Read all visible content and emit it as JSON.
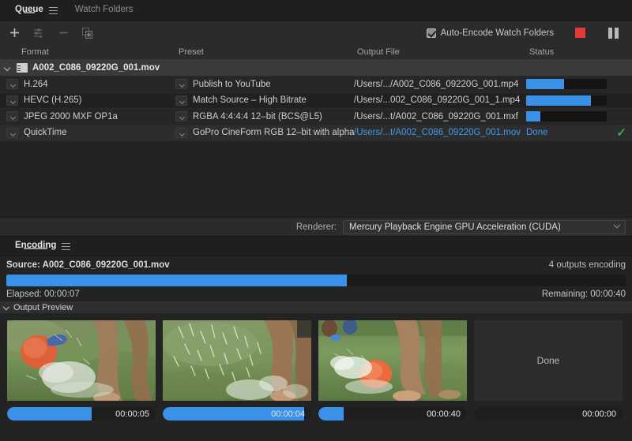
{
  "queue_panel": {
    "tabs": [
      {
        "label": "Queue",
        "active": true,
        "has_menu": true
      },
      {
        "label": "Watch Folders",
        "active": false,
        "has_menu": false
      }
    ],
    "toolbar": {
      "add_icon": "plus-icon",
      "preset_icon": "add-preset-icon",
      "remove_icon": "minus-icon",
      "duplicate_icon": "duplicate-icon",
      "auto_encode_label": "Auto-Encode Watch Folders",
      "auto_encode_checked": true,
      "stop_icon": "stop-button",
      "pause_icon": "pause-button"
    },
    "columns": [
      "Format",
      "Preset",
      "Output File",
      "Status"
    ],
    "group": {
      "name": "A002_C086_09220G_001.mov",
      "expanded": true,
      "icon": "source-clip-icon"
    },
    "rows": [
      {
        "format": "H.264",
        "preset": "Publish to YouTube",
        "output": "/Users/.../A002_C086_09220G_001.mp4",
        "status_type": "progress",
        "progress": 47,
        "status_text": ""
      },
      {
        "format": "HEVC (H.265)",
        "preset": "Match Source – High Bitrate",
        "output": "/Users/...002_C086_09220G_001_1.mp4",
        "status_type": "progress",
        "progress": 80,
        "status_text": ""
      },
      {
        "format": "JPEG 2000 MXF OP1a",
        "preset": "RGBA 4:4:4:4 12–bit (BCS@L5)",
        "output": "/Users/...t/A002_C086_09220G_001.mxf",
        "status_type": "progress",
        "progress": 18,
        "status_text": ""
      },
      {
        "format": "QuickTime",
        "preset": "GoPro CineForm RGB 12–bit with alpha",
        "output": "/Users/...t/A002_C086_09220G_001.mov",
        "status_type": "done",
        "progress": 100,
        "status_text": "Done"
      }
    ],
    "renderer": {
      "label": "Renderer:",
      "value": "Mercury Playback Engine GPU Acceleration (CUDA)"
    }
  },
  "encoding_panel": {
    "tabs": [
      {
        "label": "Encoding",
        "active": true,
        "has_menu": true
      }
    ],
    "source_label": "Source: A002_C086_09220G_001.mov",
    "outputs_encoding": "4 outputs encoding",
    "overall_progress": 55,
    "elapsed": "Elapsed: 00:00:07",
    "remaining": "Remaining: 00:00:40",
    "output_preview_label": "Output Preview",
    "output_preview_expanded": true,
    "previews": [
      {
        "kind": "image",
        "variant": "kick-ball",
        "progress": 57,
        "time": "00:00:05",
        "label": ""
      },
      {
        "kind": "image",
        "variant": "splash",
        "progress": 95,
        "time": "00:00:04",
        "label": ""
      },
      {
        "kind": "image",
        "variant": "ball-ground",
        "progress": 17,
        "time": "00:00:40",
        "label": ""
      },
      {
        "kind": "placeholder",
        "variant": "none",
        "progress": 0,
        "time": "00:00:00",
        "label": "Done"
      }
    ]
  },
  "colors": {
    "accent_blue": "#3a92e8",
    "link_blue": "#3e9bf0",
    "stop_red": "#e03a3a",
    "done_green": "#36b13b",
    "panel_bg": "#232323",
    "chrome_bg": "#2b2b2b"
  }
}
